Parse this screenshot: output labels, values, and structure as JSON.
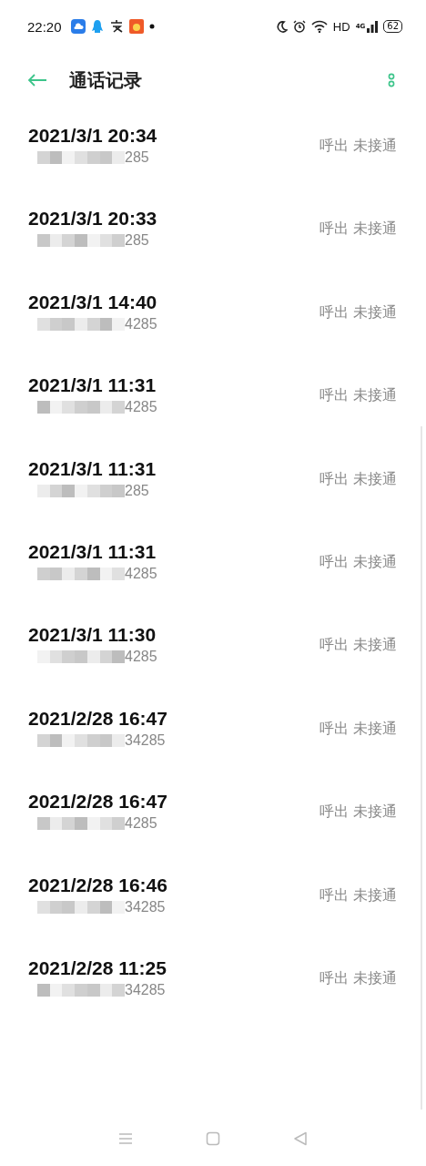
{
  "status_bar": {
    "time": "22:20",
    "network_label": "HD",
    "signal_label": "4G",
    "battery": "62"
  },
  "header": {
    "title": "通话记录"
  },
  "calls": [
    {
      "time": "2021/3/1 20:34",
      "number": "285",
      "status": "呼出 未接通"
    },
    {
      "time": "2021/3/1 20:33",
      "number": "285",
      "status": "呼出 未接通"
    },
    {
      "time": "2021/3/1 14:40",
      "number": "4285",
      "status": "呼出 未接通"
    },
    {
      "time": "2021/3/1 11:31",
      "number": "4285",
      "status": "呼出 未接通"
    },
    {
      "time": "2021/3/1 11:31",
      "number": "285",
      "status": "呼出 未接通"
    },
    {
      "time": "2021/3/1 11:31",
      "number": "4285",
      "status": "呼出 未接通"
    },
    {
      "time": "2021/3/1 11:30",
      "number": "4285",
      "status": "呼出 未接通"
    },
    {
      "time": "2021/2/28 16:47",
      "number": "34285",
      "status": "呼出 未接通"
    },
    {
      "time": "2021/2/28 16:47",
      "number": "4285",
      "status": "呼出 未接通"
    },
    {
      "time": "2021/2/28 16:46",
      "number": "34285",
      "status": "呼出 未接通"
    },
    {
      "time": "2021/2/28 11:25",
      "number": "34285",
      "status": "呼出 未接通"
    }
  ]
}
